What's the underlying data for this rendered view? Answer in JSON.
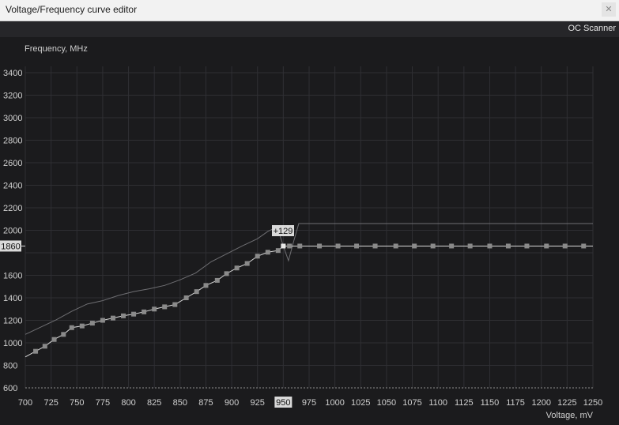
{
  "window": {
    "title": "Voltage/Frequency curve editor",
    "close_icon": "close-icon"
  },
  "toolbar": {
    "oc_scanner_label": "OC Scanner"
  },
  "badges": {
    "selected_frequency": "1860",
    "selected_voltage": "950",
    "offset": "+129"
  },
  "colors": {
    "background": "#1b1b1d",
    "grid": "#2f2f33",
    "curve": "#d8d8d8",
    "point": "#8a8a8a",
    "upper_curve": "#6f6f73",
    "badge_bg": "#d9d9d9",
    "badge_text": "#111111"
  },
  "chart_data": {
    "type": "line",
    "title": "",
    "xlabel": "Voltage, mV",
    "ylabel": "Frequency, MHz",
    "xlim": [
      700,
      1250
    ],
    "ylim": [
      600,
      3400
    ],
    "xticks": [
      700,
      725,
      750,
      775,
      800,
      825,
      850,
      875,
      900,
      925,
      950,
      975,
      1000,
      1025,
      1050,
      1075,
      1100,
      1125,
      1150,
      1175,
      1200,
      1225,
      1250
    ],
    "yticks": [
      600,
      800,
      1000,
      1200,
      1400,
      1600,
      1800,
      2000,
      2200,
      2400,
      2600,
      2800,
      3000,
      3200,
      3400
    ],
    "ytick_labels": [
      "600",
      "800",
      "1000",
      "1200",
      "1400",
      "1600",
      "1800",
      "2000",
      "2200",
      "2400",
      "2600",
      "2800",
      "3000",
      "3200",
      "3400"
    ],
    "grid": true,
    "reference_line_mhz": 600,
    "series": [
      {
        "x": [
          700,
          710,
          719,
          728,
          737,
          745,
          755,
          765,
          775,
          785,
          795,
          805,
          815,
          825,
          835,
          845,
          856,
          866,
          875,
          886,
          895,
          905,
          915,
          925,
          935,
          945,
          950,
          956,
          966,
          985,
          1003,
          1021,
          1039,
          1059,
          1077,
          1095,
          1113,
          1131,
          1150,
          1168,
          1186,
          1205,
          1223,
          1241,
          1250
        ],
        "values": [
          875,
          925,
          970,
          1030,
          1075,
          1135,
          1150,
          1175,
          1200,
          1220,
          1240,
          1255,
          1275,
          1300,
          1320,
          1340,
          1400,
          1455,
          1510,
          1555,
          1615,
          1665,
          1705,
          1770,
          1805,
          1820,
          1860,
          1860,
          1860,
          1860,
          1860,
          1860,
          1860,
          1860,
          1860,
          1860,
          1860,
          1860,
          1860,
          1860,
          1860,
          1860,
          1860,
          1860,
          1860
        ]
      },
      {
        "x": [
          700,
          715,
          730,
          745,
          760,
          775,
          790,
          805,
          820,
          835,
          850,
          865,
          880,
          895,
          910,
          925,
          935,
          944,
          950,
          955,
          960,
          965,
          1250
        ],
        "values": [
          1075,
          1140,
          1205,
          1280,
          1345,
          1375,
          1420,
          1455,
          1480,
          1510,
          1560,
          1620,
          1720,
          1790,
          1860,
          1925,
          1990,
          2030,
          1860,
          1730,
          1900,
          2060,
          2060
        ]
      }
    ]
  }
}
